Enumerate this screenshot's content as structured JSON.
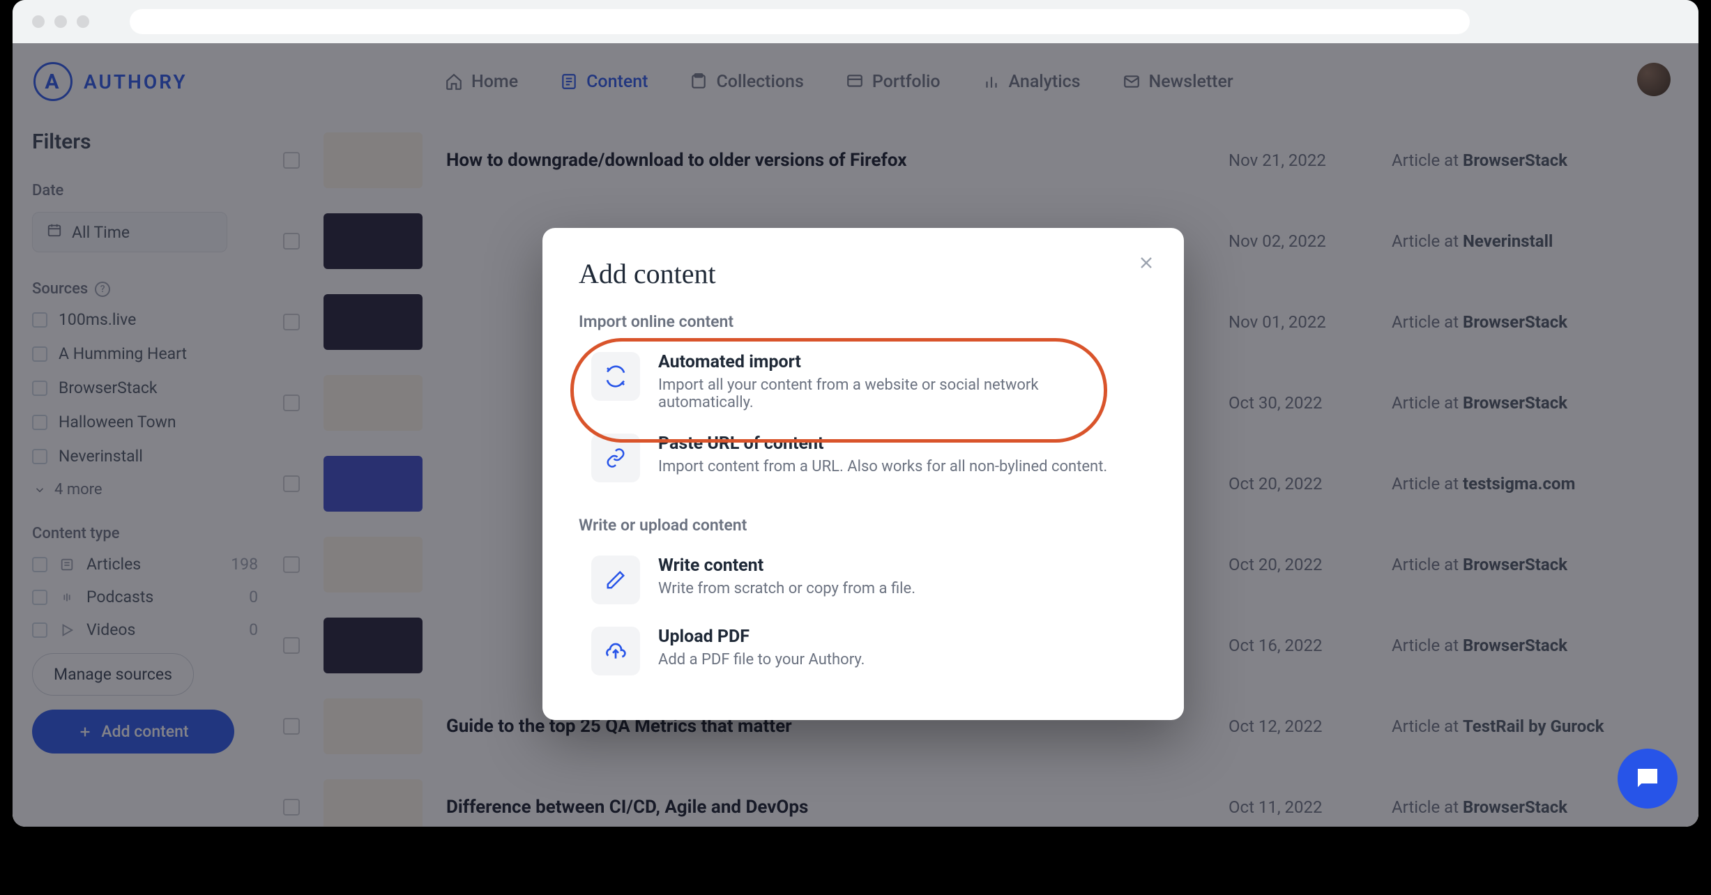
{
  "brand": {
    "name": "AUTHORY",
    "letter": "A"
  },
  "nav": {
    "home": "Home",
    "content": "Content",
    "collections": "Collections",
    "portfolio": "Portfolio",
    "analytics": "Analytics",
    "newsletter": "Newsletter"
  },
  "filters": {
    "heading": "Filters",
    "date_label": "Date",
    "date_value": "All Time",
    "sources_label": "Sources",
    "sources": [
      "100ms.live",
      "A Humming Heart",
      "BrowserStack",
      "Halloween Town",
      "Neverinstall"
    ],
    "more": "4 more",
    "content_type_label": "Content type",
    "types": [
      {
        "label": "Articles",
        "count": "198"
      },
      {
        "label": "Podcasts",
        "count": "0"
      },
      {
        "label": "Videos",
        "count": "0"
      }
    ],
    "manage": "Manage sources",
    "add": "Add content"
  },
  "rows": [
    {
      "title": "How to downgrade/download to older versions of Firefox",
      "date": "Nov 21, 2022",
      "src": "BrowserStack",
      "thumb": "light"
    },
    {
      "title": "",
      "date": "Nov 02, 2022",
      "src": "Neverinstall",
      "thumb": "dark"
    },
    {
      "title": "",
      "date": "Nov 01, 2022",
      "src": "BrowserStack",
      "thumb": "dark"
    },
    {
      "title": "",
      "date": "Oct 30, 2022",
      "src": "BrowserStack",
      "thumb": "light"
    },
    {
      "title": "",
      "date": "Oct 20, 2022",
      "src": "testsigma.com",
      "thumb": "blue"
    },
    {
      "title": "",
      "date": "Oct 20, 2022",
      "src": "BrowserStack",
      "thumb": "light"
    },
    {
      "title": "",
      "date": "Oct 16, 2022",
      "src": "BrowserStack",
      "thumb": "dark"
    },
    {
      "title": "Guide to the top 25 QA Metrics that matter",
      "date": "Oct 12, 2022",
      "src": "TestRail by Gurock",
      "thumb": "light"
    },
    {
      "title": "Difference between CI/CD, Agile and DevOps",
      "date": "Oct 11, 2022",
      "src": "BrowserStack",
      "thumb": "light"
    }
  ],
  "article_prefix": "Article at ",
  "modal": {
    "title": "Add content",
    "section_import": "Import online content",
    "section_write": "Write or upload content",
    "opt_auto_title": "Automated import",
    "opt_auto_desc": "Import all your content from a website or social network automatically.",
    "opt_url_title": "Paste URL of content",
    "opt_url_desc": "Import content from a URL. Also works for all non-bylined content.",
    "opt_write_title": "Write content",
    "opt_write_desc": "Write from scratch or copy from a file.",
    "opt_pdf_title": "Upload PDF",
    "opt_pdf_desc": "Add a PDF file to your Authory."
  }
}
